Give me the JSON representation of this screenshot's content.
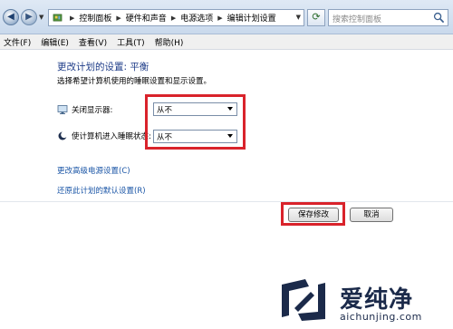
{
  "breadcrumb": [
    "控制面板",
    "硬件和声音",
    "电源选项",
    "编辑计划设置"
  ],
  "search": {
    "placeholder": "搜索控制面板"
  },
  "menu": [
    {
      "label": "文件(F)"
    },
    {
      "label": "编辑(E)"
    },
    {
      "label": "查看(V)"
    },
    {
      "label": "工具(T)"
    },
    {
      "label": "帮助(H)"
    }
  ],
  "content": {
    "title": "更改计划的设置: 平衡",
    "subtitle": "选择希望计算机使用的睡眠设置和显示设置。",
    "settings": [
      {
        "label": "关闭显示器:",
        "value": "从不",
        "icon": "monitor-icon"
      },
      {
        "label": "使计算机进入睡眠状态:",
        "value": "从不",
        "icon": "moon-icon"
      }
    ],
    "links": {
      "advanced": "更改高级电源设置(C)",
      "restore": "还原此计划的默认设置(R)"
    },
    "buttons": {
      "save": "保存修改",
      "cancel": "取消"
    }
  },
  "watermark": {
    "brand": "爱纯净",
    "url": "aichunjing.com"
  },
  "colors": {
    "highlight": "#d9232b",
    "title": "#1e3c88",
    "link": "#1a55a6"
  }
}
